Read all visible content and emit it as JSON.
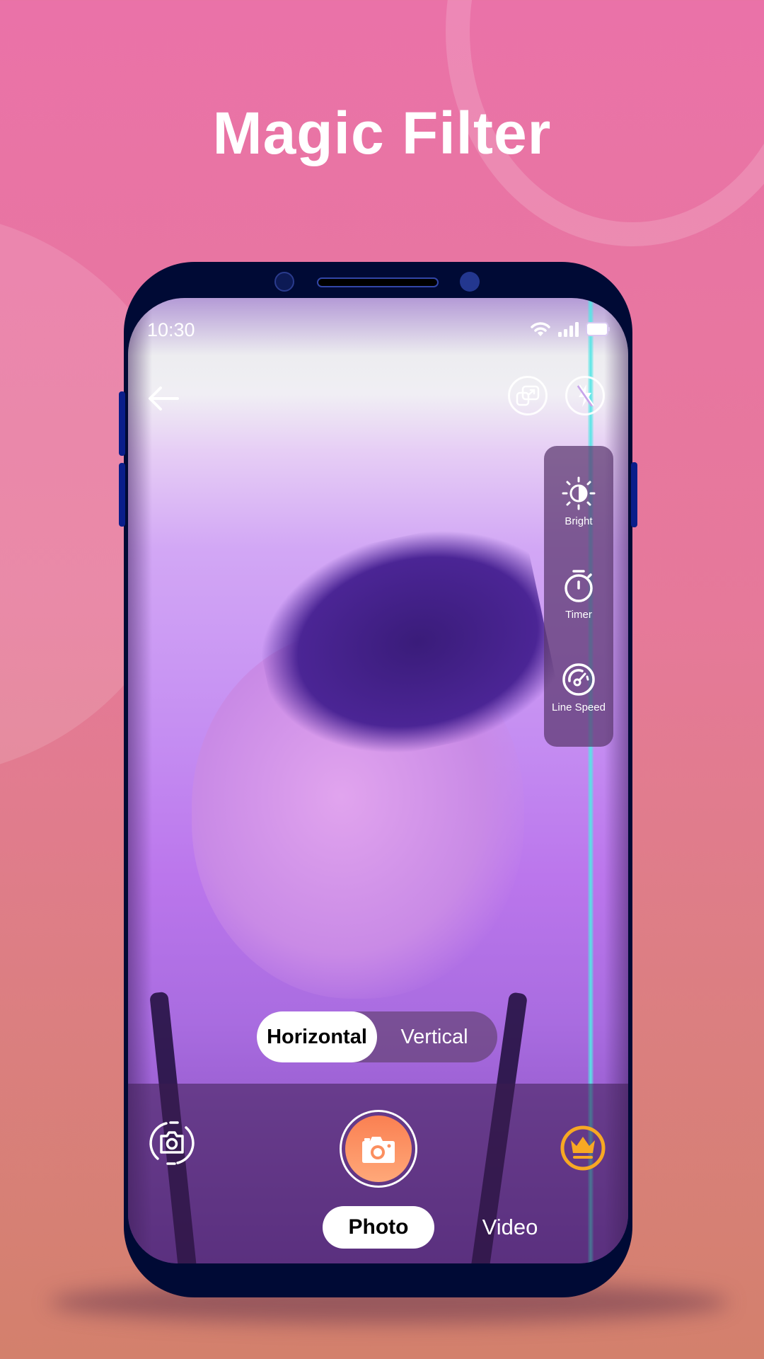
{
  "promo": {
    "title": "Magic Filter",
    "colors": {
      "background_top": "#ea72a8",
      "background_bottom": "#d3806c",
      "phone_frame": "#000a35",
      "shutter_accent": "#fa8052",
      "premium_accent": "#f7a823",
      "scan_line": "#56e6e6"
    }
  },
  "status_bar": {
    "time": "10:30",
    "icons": [
      "wifi-icon",
      "signal-icon",
      "battery-icon"
    ]
  },
  "top_bar": {
    "back_icon": "arrow-left-icon",
    "actions": [
      {
        "name": "aspect-ratio",
        "icon": "resize-icon"
      },
      {
        "name": "flash",
        "icon": "flash-off-icon"
      }
    ]
  },
  "side_panel": {
    "items": [
      {
        "label": "Bright",
        "icon": "brightness-icon"
      },
      {
        "label": "Timer",
        "icon": "timer-icon"
      },
      {
        "label": "Line Speed",
        "icon": "speedometer-icon"
      }
    ]
  },
  "direction_toggle": {
    "options": [
      "Horizontal",
      "Vertical"
    ],
    "selected": "Horizontal"
  },
  "capture_bar": {
    "switch_camera_icon": "switch-camera-icon",
    "shutter_icon": "camera-icon",
    "premium_icon": "crown-icon"
  },
  "mode_tabs": {
    "options": [
      "Photo",
      "Video"
    ],
    "selected": "Photo"
  }
}
